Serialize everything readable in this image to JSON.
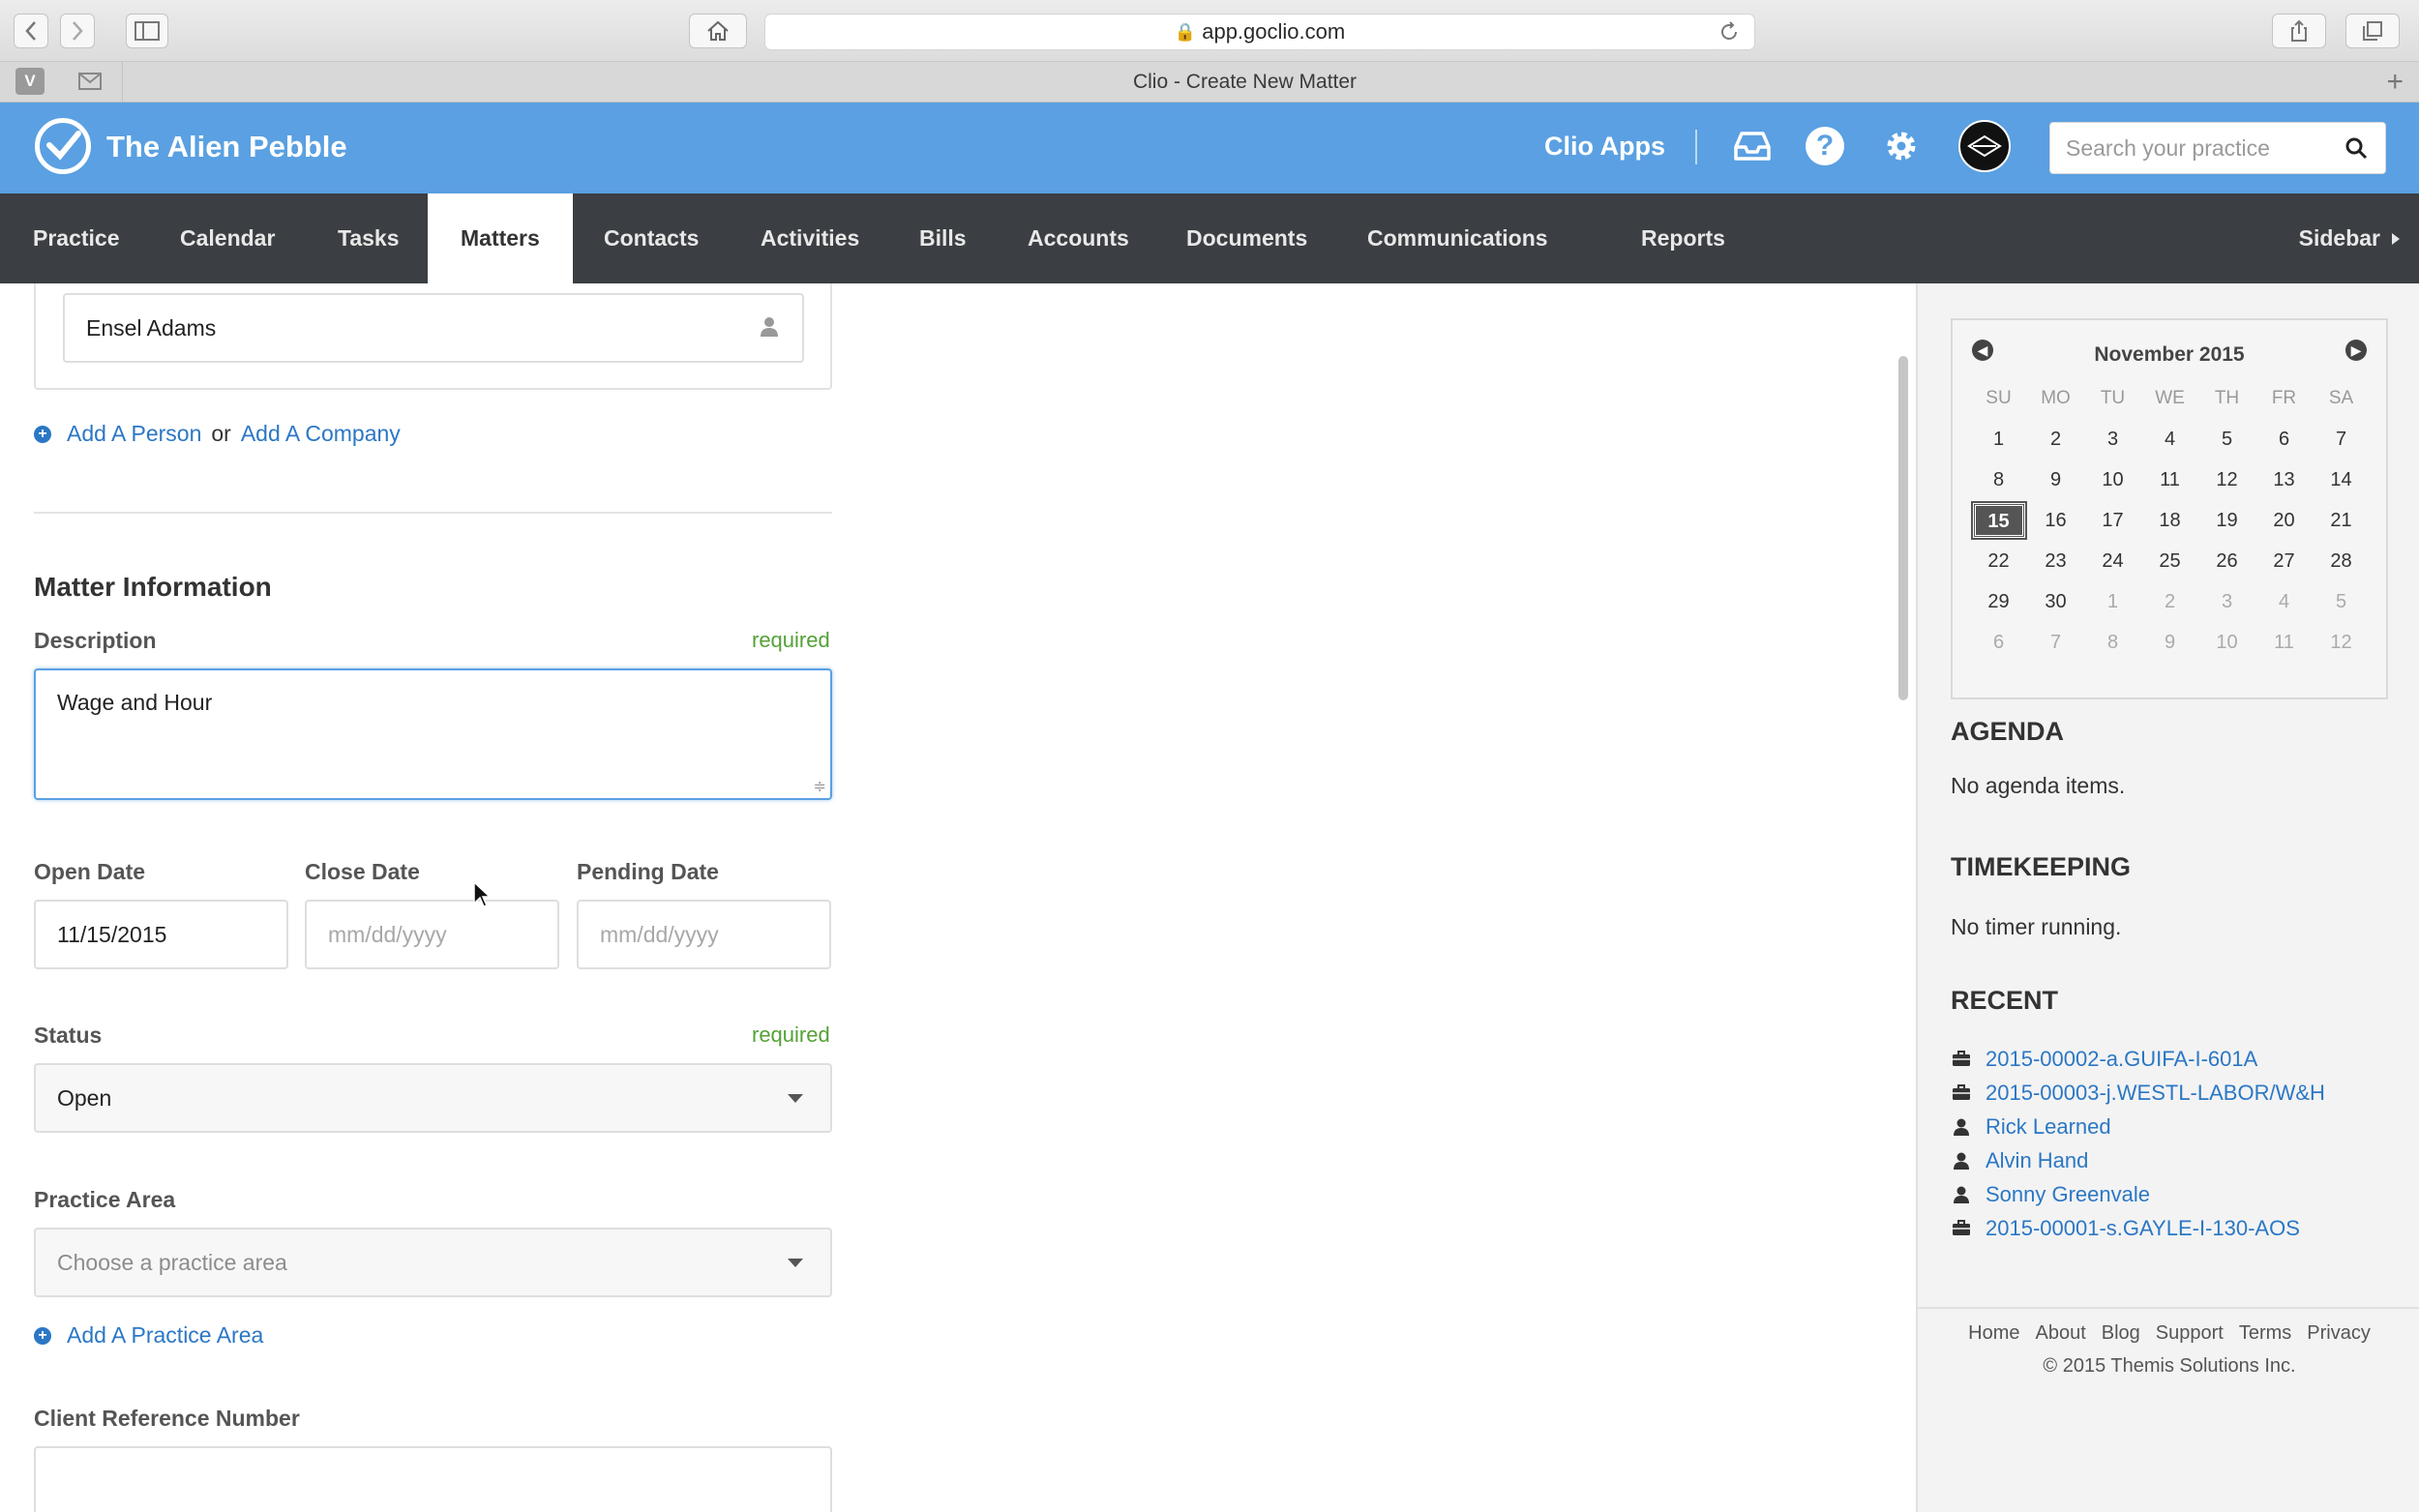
{
  "browser": {
    "url": "app.goclio.com",
    "tab_title": "Clio - Create New Matter",
    "pinned_tabs": [
      "V",
      "mail"
    ]
  },
  "header": {
    "brand": "The Alien Pebble",
    "clio_apps": "Clio Apps",
    "search_placeholder": "Search your practice",
    "accent_color": "#5aa0e2"
  },
  "nav": {
    "items": [
      "Practice",
      "Calendar",
      "Tasks",
      "Matters",
      "Contacts",
      "Activities",
      "Bills",
      "Accounts",
      "Documents",
      "Communications",
      "Reports"
    ],
    "active": "Matters",
    "sidebar_toggle": "Sidebar"
  },
  "form": {
    "client_value": "Ensel Adams",
    "add_person": "Add A Person",
    "or_text": "or",
    "add_company": "Add A Company",
    "section_title": "Matter Information",
    "description_label": "Description",
    "required_text": "required",
    "description_value": "Wage and Hour",
    "open_date_label": "Open Date",
    "open_date_value": "11/15/2015",
    "close_date_label": "Close Date",
    "close_date_placeholder": "mm/dd/yyyy",
    "pending_date_label": "Pending Date",
    "pending_date_placeholder": "mm/dd/yyyy",
    "status_label": "Status",
    "status_value": "Open",
    "practice_area_label": "Practice Area",
    "practice_area_placeholder": "Choose a practice area",
    "add_practice_area": "Add A Practice Area",
    "client_ref_label": "Client Reference Number"
  },
  "sidebar": {
    "calendar": {
      "month": "November 2015",
      "days_of_week": [
        "SU",
        "MO",
        "TU",
        "WE",
        "TH",
        "FR",
        "SA"
      ],
      "weeks": [
        [
          "1",
          "2",
          "3",
          "4",
          "5",
          "6",
          "7"
        ],
        [
          "8",
          "9",
          "10",
          "11",
          "12",
          "13",
          "14"
        ],
        [
          "15",
          "16",
          "17",
          "18",
          "19",
          "20",
          "21"
        ],
        [
          "22",
          "23",
          "24",
          "25",
          "26",
          "27",
          "28"
        ],
        [
          "29",
          "30",
          "1",
          "2",
          "3",
          "4",
          "5"
        ],
        [
          "6",
          "7",
          "8",
          "9",
          "10",
          "11",
          "12"
        ]
      ],
      "today": "15"
    },
    "agenda_title": "AGENDA",
    "agenda_text": "No agenda items.",
    "timekeeping_title": "TIMEKEEPING",
    "timekeeping_text": "No timer running.",
    "recent_title": "RECENT",
    "recent": [
      {
        "label": "2015-00002-a.GUIFA-I-601A",
        "icon": "briefcase-icon"
      },
      {
        "label": "2015-00003-j.WESTL-LABOR/W&H",
        "icon": "briefcase-icon"
      },
      {
        "label": "Rick Learned",
        "icon": "person-icon"
      },
      {
        "label": "Alvin Hand",
        "icon": "person-icon"
      },
      {
        "label": "Sonny Greenvale",
        "icon": "person-icon"
      },
      {
        "label": "2015-00001-s.GAYLE-I-130-AOS",
        "icon": "briefcase-icon"
      }
    ],
    "footer_links": [
      "Home",
      "About",
      "Blog",
      "Support",
      "Terms",
      "Privacy"
    ],
    "copyright": "© 2015 Themis Solutions Inc."
  }
}
